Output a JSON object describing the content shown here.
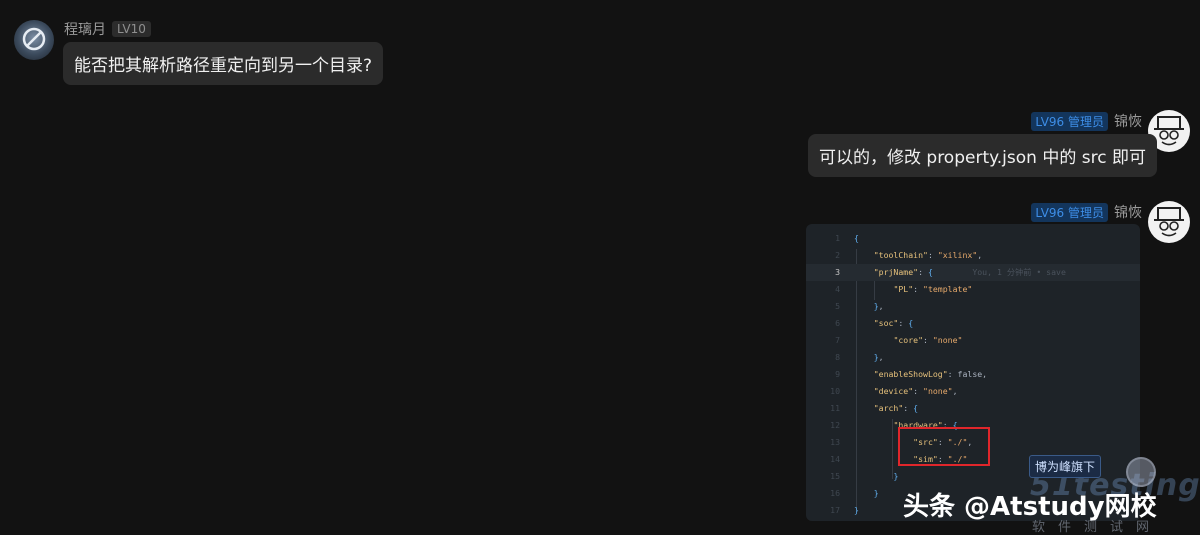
{
  "msg1": {
    "username": "程璃月",
    "level": "LV10",
    "text": "能否把其解析路径重定向到另一个目录?"
  },
  "msg2": {
    "username": "锦恢",
    "level": "LV96 管理员",
    "text": "可以的，修改 property.json 中的 src 即可"
  },
  "msg3": {
    "username": "锦恢",
    "level": "LV96 管理员",
    "code_lines": [
      {
        "n": "1",
        "html": "<span class='b'>{</span>"
      },
      {
        "n": "2",
        "html": "    <span class='k'>\"toolChain\"</span><span class='p'>: </span><span class='s'>\"xilinx\"</span><span class='p'>,</span>"
      },
      {
        "n": "3",
        "html": "    <span class='k'>\"prjName\"</span><span class='p'>: </span><span class='b'>{</span>        <span class='hint'>You, 1 分钟前 • save</span>"
      },
      {
        "n": "4",
        "html": "        <span class='k'>\"PL\"</span><span class='p'>: </span><span class='s'>\"template\"</span>"
      },
      {
        "n": "5",
        "html": "    <span class='b'>}</span><span class='p'>,</span>"
      },
      {
        "n": "6",
        "html": "    <span class='k'>\"soc\"</span><span class='p'>: </span><span class='b'>{</span>"
      },
      {
        "n": "7",
        "html": "        <span class='k'>\"core\"</span><span class='p'>: </span><span class='s'>\"none\"</span>"
      },
      {
        "n": "8",
        "html": "    <span class='b'>}</span><span class='p'>,</span>"
      },
      {
        "n": "9",
        "html": "    <span class='k'>\"enableShowLog\"</span><span class='p'>: false,</span>"
      },
      {
        "n": "10",
        "html": "    <span class='k'>\"device\"</span><span class='p'>: </span><span class='s'>\"none\"</span><span class='p'>,</span>"
      },
      {
        "n": "11",
        "html": "    <span class='k'>\"arch\"</span><span class='p'>: </span><span class='b'>{</span>"
      },
      {
        "n": "12",
        "html": "        <span class='k'>\"hardware\"</span><span class='p'>: </span><span class='b'>{</span>"
      },
      {
        "n": "13",
        "html": "            <span class='k'>\"src\"</span><span class='p'>: </span><span class='s'>\"./\"</span><span class='p'>,</span>"
      },
      {
        "n": "14",
        "html": "            <span class='k'>\"sim\"</span><span class='p'>: </span><span class='s'>\"./\"</span>"
      },
      {
        "n": "15",
        "html": "        <span class='b'>}</span>"
      },
      {
        "n": "16",
        "html": "    <span class='b'>}</span>"
      },
      {
        "n": "17",
        "html": "<span class='b'>}</span>"
      }
    ],
    "active_line": "3"
  },
  "watermark": {
    "tag": "博为峰旗下",
    "brand": "51testing",
    "sub": "软件测试网",
    "source": "头条 @Atstudy网校"
  },
  "colors": {
    "background": "#121212",
    "bubble": "#2b2b2b",
    "admin_badge": "#3d8de6",
    "highlight_box": "#e0262b"
  }
}
